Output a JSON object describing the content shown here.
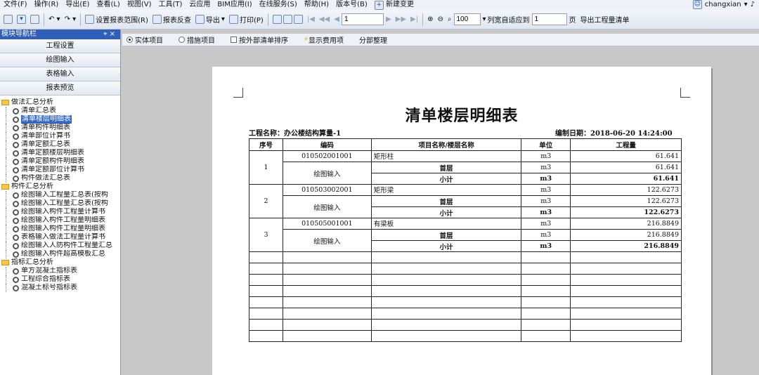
{
  "menu": [
    "文件(F)",
    "操作(R)",
    "导出(E)",
    "查看(L)",
    "视图(V)",
    "工具(T)",
    "云应用",
    "BIM应用(I)",
    "在线服务(S)",
    "帮助(H)",
    "版本号(B)",
    "新建变更"
  ],
  "user": "changxian",
  "toolbar": {
    "set_range": "设置报表范围(R)",
    "report_check": "报表反查",
    "export": "导出",
    "print": "打印(P)",
    "page_value": "1",
    "zoom_value": "100",
    "col_width_label": "列宽自适应到",
    "col_width_value": "1",
    "page_unit": "页",
    "export_bill": "导出工程量清单"
  },
  "left_panel": {
    "title": "模块导航栏",
    "nav_buttons": [
      "工程设置",
      "绘图输入",
      "表格输入",
      "报表预览"
    ],
    "groups": [
      {
        "label": "做法汇总分析",
        "items": [
          "清单汇总表",
          "清单楼层明细表",
          "清单构件明细表",
          "清单部位计算书",
          "清单定额汇总表",
          "清单定额楼层明细表",
          "清单定额构件明细表",
          "清单定额部位计算书",
          "构件做法汇总表"
        ]
      },
      {
        "label": "构件汇总分析",
        "items": [
          "绘图输入工程量汇总表(按构",
          "绘图输入工程量汇总表(按构",
          "绘图输入构件工程量计算书",
          "绘图输入构件工程量明细表",
          "绘图输入构件工程量明细表",
          "表格输入做法工程量计算书",
          "绘图输入人防构件工程量汇总",
          "绘图输入构件超高模板汇总"
        ]
      },
      {
        "label": "指标汇总分析",
        "items": [
          "单方混凝土指标表",
          "工程综合指标表",
          "混凝土标号指标表"
        ]
      }
    ],
    "selected_item": "清单楼层明细表"
  },
  "options": {
    "radio_entity": "实体项目",
    "radio_measure": "措施项目",
    "check_sort": "按外部清单排序",
    "show_fee": "显示费用项",
    "section": "分部整理"
  },
  "report": {
    "title": "清单楼层明细表",
    "project_label": "工程名称：办公楼结构算量-1",
    "date_label": "编制日期：2018-06-20 14:24:00",
    "headers": [
      "序号",
      "编码",
      "项目名称/楼层名称",
      "单位",
      "工程量"
    ],
    "rows": [
      {
        "no": "1",
        "code": "010502001001",
        "name": "矩形柱",
        "unit": "m3",
        "qty": "61.641",
        "source": "绘图输入",
        "floor": "首层",
        "floor_qty": "61.641",
        "subtotal_label": "小计",
        "subtotal": "61.641"
      },
      {
        "no": "2",
        "code": "010503002001",
        "name": "矩形梁",
        "unit": "m3",
        "qty": "122.6273",
        "source": "绘图输入",
        "floor": "首层",
        "floor_qty": "122.6273",
        "subtotal_label": "小计",
        "subtotal": "122.6273"
      },
      {
        "no": "3",
        "code": "010505001001",
        "name": "有梁板",
        "unit": "m3",
        "qty": "216.8849",
        "source": "绘图输入",
        "floor": "首层",
        "floor_qty": "216.8849",
        "subtotal_label": "小计",
        "subtotal": "216.8849"
      }
    ]
  }
}
